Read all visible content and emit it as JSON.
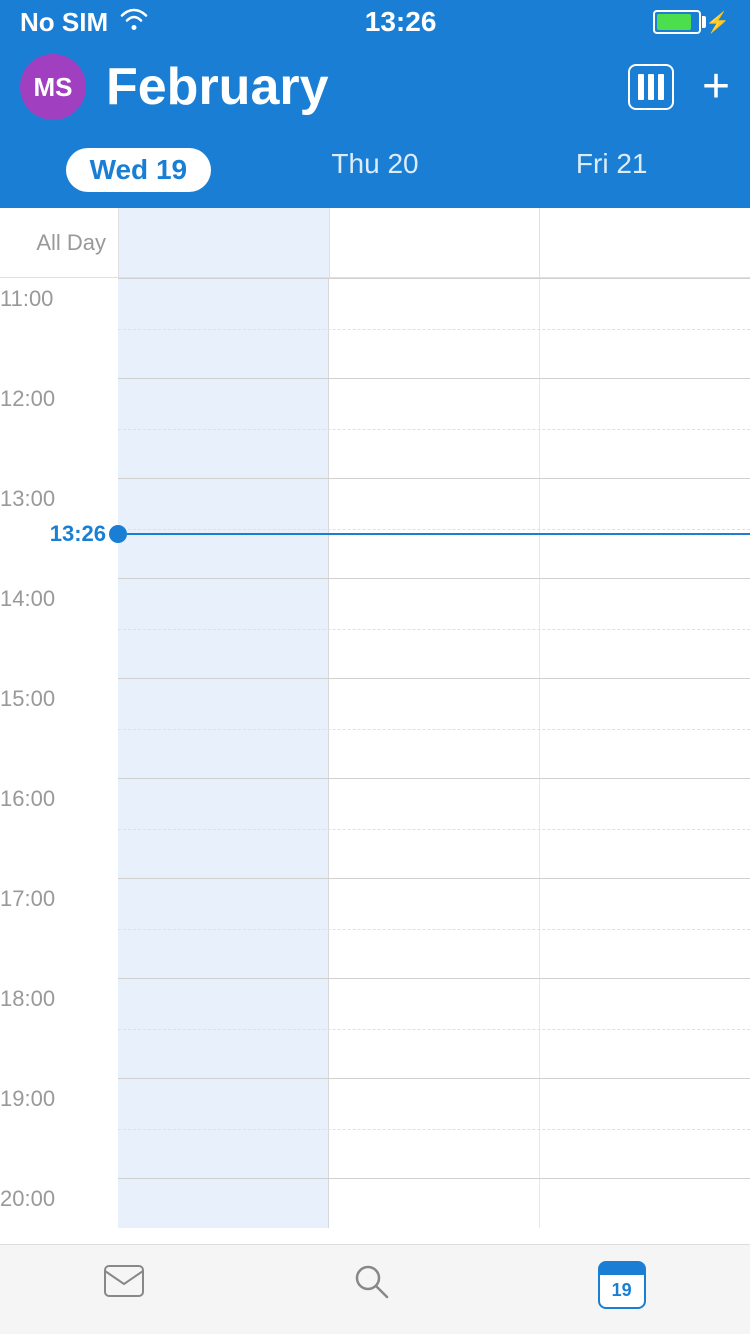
{
  "status_bar": {
    "carrier": "No SIM",
    "time": "13:26",
    "wifi": true,
    "battery_level": 85
  },
  "header": {
    "avatar_initials": "MS",
    "month_title": "February",
    "grid_icon_label": "grid-icon",
    "add_button_label": "+"
  },
  "day_selector": {
    "days": [
      {
        "label": "Wed 19",
        "active": true
      },
      {
        "label": "Thu 20",
        "active": false
      },
      {
        "label": "Fri 21",
        "active": false
      }
    ]
  },
  "calendar": {
    "all_day_label": "All Day",
    "current_time": "13:26",
    "hours": [
      "11:00",
      "12:00",
      "13:00",
      "14:00",
      "15:00",
      "16:00",
      "17:00",
      "18:00",
      "19:00",
      "20:00"
    ]
  },
  "tab_bar": {
    "items": [
      {
        "icon": "mail",
        "label": "Mail"
      },
      {
        "icon": "search",
        "label": "Search"
      },
      {
        "icon": "calendar",
        "label": "Calendar",
        "badge": "19"
      }
    ]
  }
}
